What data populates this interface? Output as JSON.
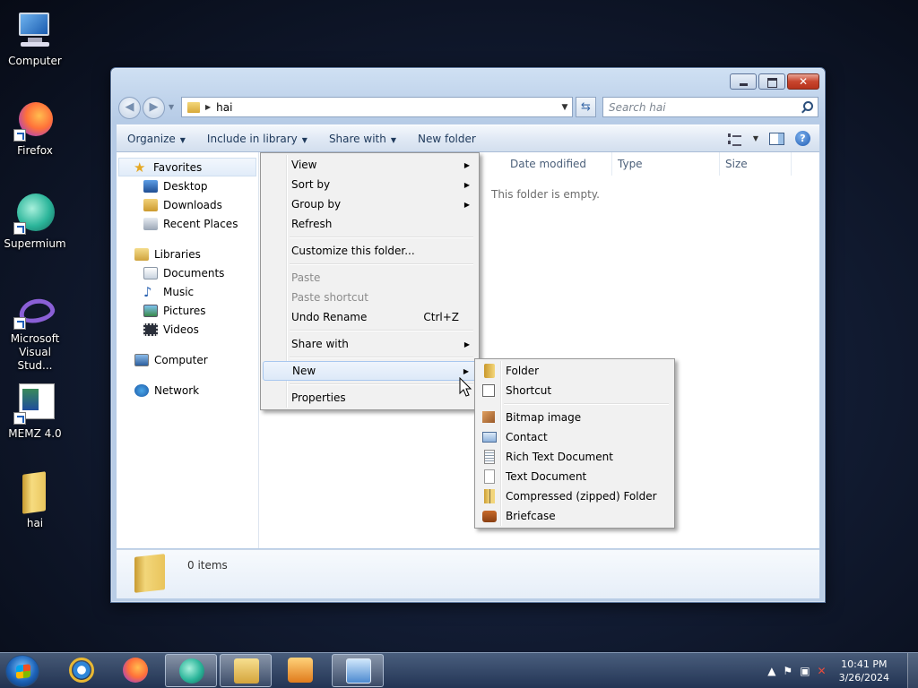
{
  "desktop": {
    "icons": [
      {
        "label": "Computer"
      },
      {
        "label": "Firefox"
      },
      {
        "label": "Supermium"
      },
      {
        "label": "Microsoft Visual Stud..."
      },
      {
        "label": "MEMZ 4.0"
      },
      {
        "label": "hai"
      }
    ]
  },
  "window": {
    "address": {
      "path": "hai"
    },
    "search": {
      "placeholder": "Search hai"
    },
    "toolbar": {
      "organize": "Organize",
      "include_in_library": "Include in library",
      "share_with": "Share with",
      "new_folder": "New folder"
    },
    "nav": {
      "favorites": "Favorites",
      "desktop": "Desktop",
      "downloads": "Downloads",
      "recent_places": "Recent Places",
      "libraries": "Libraries",
      "documents": "Documents",
      "music": "Music",
      "pictures": "Pictures",
      "videos": "Videos",
      "computer": "Computer",
      "network": "Network"
    },
    "columns": {
      "date_modified": "Date modified",
      "type": "Type",
      "size": "Size"
    },
    "empty_message": "This folder is empty.",
    "details": {
      "count": "0 items"
    }
  },
  "context_menu": {
    "view": "View",
    "sort_by": "Sort by",
    "group_by": "Group by",
    "refresh": "Refresh",
    "customize": "Customize this folder...",
    "paste": "Paste",
    "paste_shortcut": "Paste shortcut",
    "undo_rename": "Undo Rename",
    "undo_shortcut": "Ctrl+Z",
    "share_with": "Share with",
    "new": "New",
    "properties": "Properties"
  },
  "new_submenu": {
    "folder": "Folder",
    "shortcut": "Shortcut",
    "bitmap": "Bitmap image",
    "contact": "Contact",
    "rtf": "Rich Text Document",
    "text": "Text Document",
    "zip": "Compressed (zipped) Folder",
    "briefcase": "Briefcase"
  },
  "taskbar": {
    "clock_time": "10:41 PM",
    "clock_date": "3/26/2024"
  },
  "colors": {
    "accent": "#1d63b8",
    "menu_highlight": "#dde9f8",
    "toolbar_text": "#1e395b"
  }
}
